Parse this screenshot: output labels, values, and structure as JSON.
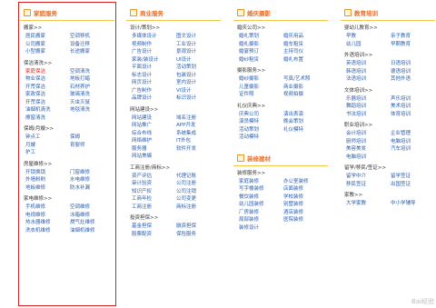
{
  "columns": [
    {
      "title": "家庭服务",
      "sections": [
        {
          "title": "搬家>>",
          "items": [
            "居民搬家",
            "空调移机",
            "公司搬家",
            "设备迁移",
            "小型搬家",
            "长途搬家"
          ]
        },
        {
          "title": "保洁清洗>>",
          "items": [
            "家庭保洁",
            "空调清洗",
            "物业保洁",
            "地板打蜡",
            "开荒保洁",
            "石材养护",
            "家政保洁",
            "玻璃清洗",
            "开荒保洁",
            "灭虫灭鼠",
            "油烟机清洗",
            "地毯清洗",
            "擦窗清洗",
            ""
          ]
        },
        {
          "title": "保姆/月嫂>>",
          "items": [
            "钟点工",
            "保姆",
            "月嫂",
            "育婴师",
            "护工",
            ""
          ]
        },
        {
          "title": "房屋维修>>",
          "items": [
            "开锁换锁",
            "门窗维修",
            "外墙粉刷",
            "水电维修",
            "地板维修",
            "防水补漏"
          ]
        },
        {
          "title": "家电维修>>",
          "items": [
            "手机维修",
            "空调维修",
            "电视维修",
            "冰箱维修",
            "热水器维修",
            "燃气灶维修",
            "洗衣机维修",
            "油烟机维修"
          ]
        }
      ]
    },
    {
      "title": "商业服务",
      "sections": [
        {
          "title": "设计/策划>>",
          "items": [
            "多媒体设计",
            "图文设计",
            "视频制作",
            "工业设计",
            "广告设计",
            "景观设计",
            "家装/装设计",
            "UI设计",
            "平面设计",
            "活动策划",
            "标志设计",
            "包装设计",
            "网页设计",
            "室内设计",
            "广告制作",
            "VI设计",
            "品牌设计",
            "标识设计"
          ]
        },
        {
          "title": "网站建设>>",
          "items": [
            "网站建设",
            "域名注册",
            "网站推广",
            "APP开发",
            "综合布线",
            "系统集成",
            "网络维护",
            "IT外包",
            "服务器",
            "软件开发",
            "网站美编",
            ""
          ]
        },
        {
          "title": "工商注册/商标>>",
          "items": [
            "资产评估",
            "代理记账",
            "审计验资",
            "公司注册",
            "知识产权",
            "公司注销",
            "工商年检",
            "公司变更",
            "工商注册",
            "商标注册"
          ]
        },
        {
          "title": "投资担保>>",
          "items": [
            "基金担保",
            "融资担保",
            "股票配资",
            "保险服务"
          ]
        }
      ]
    },
    {
      "title": "婚庆摄影",
      "sections": [
        {
          "title": "婚庆公司>>",
          "items": [
            "婚礼策划",
            "婚庆用品",
            "婚礼摄影",
            "婚车租赁",
            "婚宴预订",
            "主持司仪",
            "婚纱租赁",
            "婚礼布置"
          ]
        },
        {
          "title": "摄影服务>>",
          "items": [
            "婚纱摄影",
            "写真/艺术照",
            "儿童摄影",
            "商业摄影",
            "证件照",
            "视频拍摄"
          ]
        },
        {
          "title": "礼仪庆典>>",
          "items": [
            "庆典公司",
            "演出表演",
            "演员模特",
            "晚会策划",
            "活动策划",
            "礼仪模特",
            "活动模特",
            ""
          ]
        }
      ]
    },
    {
      "title": "装修建材",
      "sections": [
        {
          "title": "装修服务>>",
          "items": [
            "家庭装修",
            "办公室装修",
            "写字楼装修",
            "店面装修",
            "餐饮装修",
            "学校装修",
            "幼儿园装修",
            "别墅装修",
            "厂房装修",
            "酒店装修",
            "局部装修",
            "医院装修",
            "装修设计",
            ""
          ]
        }
      ]
    },
    {
      "title": "教育培训",
      "sections": [
        {
          "title": "婴幼儿教育>>",
          "items": [
            "早教",
            "亲子教育",
            "幼儿园",
            "早期教育"
          ]
        },
        {
          "title": "外语培训>>",
          "items": [
            "英语培训",
            "日语培训",
            "韩语培训",
            "德语培训",
            "法语培训",
            "其他外语"
          ]
        },
        {
          "title": "文体培训>>",
          "items": [
            "乐器培训",
            "声乐培训",
            "舞蹈培训",
            "美术培训",
            "书法培训",
            "体育培训"
          ]
        },
        {
          "title": "职业培训>>",
          "items": [
            "会计培训",
            "企业管理",
            "厨师培训",
            "电脑培训",
            "美容美发",
            "汽车培训",
            "电脑培训",
            ""
          ]
        },
        {
          "title": "留学/移民/签证>>",
          "items": [
            "留学中介",
            "留学签证",
            "移民签证",
            "出国签证"
          ]
        },
        {
          "title": "家教>>",
          "items": [
            "大学家教",
            "中小学辅导"
          ]
        }
      ]
    }
  ],
  "highlight": {
    "section": "保洁清洗",
    "item": "家庭保洁"
  },
  "watermark": "Bai经验",
  "colors": {
    "accent": "#e8702a",
    "link": "#2a5db0",
    "frame": "#d81e1e",
    "rule": "#f3c54a"
  }
}
